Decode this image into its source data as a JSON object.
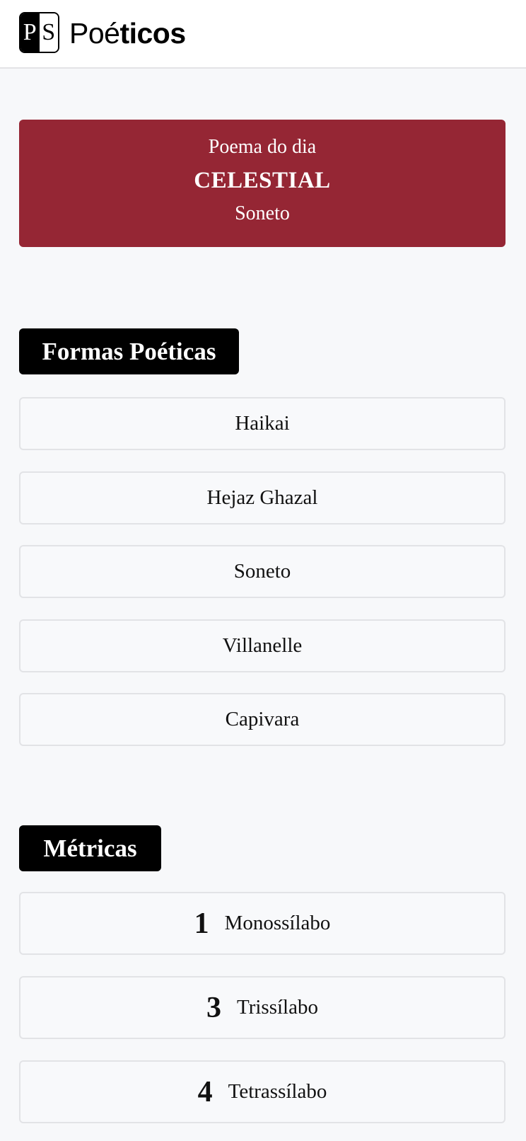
{
  "header": {
    "logo_left": "P",
    "logo_right": "S",
    "brand_thin": "Poé",
    "brand_bold": "ticos"
  },
  "poem_of_day": {
    "kicker": "Poema do dia",
    "title": "CELESTIAL",
    "form": "Soneto",
    "color": "#952634"
  },
  "forms": {
    "heading": "Formas Poéticas",
    "items": [
      {
        "label": "Haikai"
      },
      {
        "label": "Hejaz Ghazal"
      },
      {
        "label": "Soneto"
      },
      {
        "label": "Villanelle"
      },
      {
        "label": "Capivara"
      }
    ]
  },
  "metrics": {
    "heading": "Métricas",
    "items": [
      {
        "number": "1",
        "label": "Monossílabo"
      },
      {
        "number": "3",
        "label": "Trissílabo"
      },
      {
        "number": "4",
        "label": "Tetrassílabo"
      }
    ]
  }
}
